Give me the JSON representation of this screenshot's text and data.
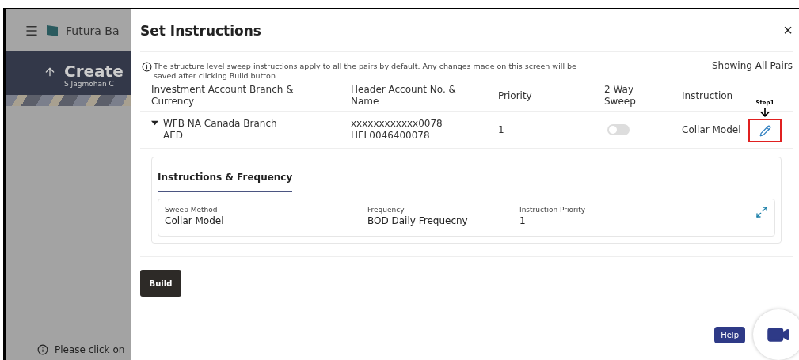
{
  "background": {
    "brand": "Futura Ba",
    "title": "Create",
    "subtitle": "S Jagmohan C",
    "note": "Please click on"
  },
  "modal": {
    "title": "Set Instructions",
    "close": "×",
    "info": "The structure level sweep instructions apply to all the pairs by default. Any changes made on this screen will be saved after clicking Build button.",
    "filter": "Showing All Pairs",
    "columns": [
      "Investment Account Branch & Currency",
      "Header Account No. & Name",
      "Priority",
      "2 Way Sweep",
      "Instruction"
    ],
    "rows": [
      {
        "branch": "WFB NA Canada Branch",
        "currency": "AED",
        "account_no": "xxxxxxxxxxxx0078",
        "account_name": "HEL0046400078",
        "priority": "1",
        "two_way_sweep": false,
        "instruction": "Collar Model",
        "expanded": true
      }
    ],
    "annotation": "Step1",
    "tabs": [
      {
        "label": "Instructions & Frequency",
        "selected": true
      }
    ],
    "details": [
      {
        "label": "Sweep Method",
        "value": "Collar Model"
      },
      {
        "label": "Frequency",
        "value": "BOD Daily Frequecny"
      },
      {
        "label": "Instruction Priority",
        "value": "1"
      }
    ],
    "build": "Build",
    "help": "Help"
  }
}
